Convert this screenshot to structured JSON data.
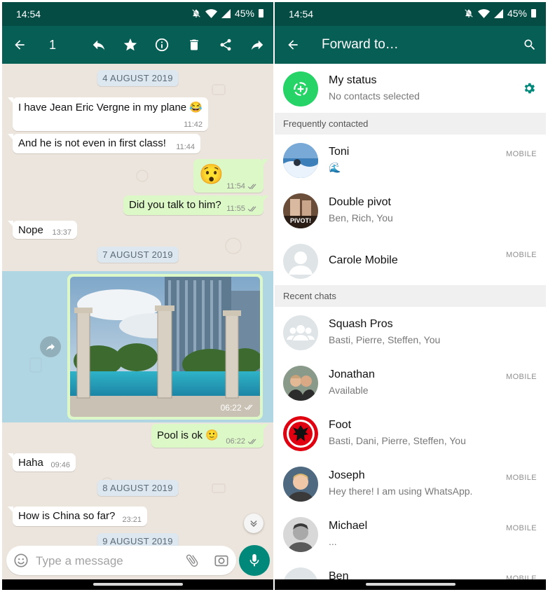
{
  "left": {
    "status_time": "14:54",
    "battery": "45%",
    "selected_count": "1",
    "chat": {
      "dates": [
        "4 AUGUST 2019",
        "7 AUGUST 2019",
        "8 AUGUST 2019",
        "9 AUGUST 2019"
      ],
      "messages": [
        {
          "dir": "in",
          "text": "I have Jean Eric Vergne in my plane 😂",
          "time": "11:42"
        },
        {
          "dir": "in",
          "text": "And he is not even in first class!",
          "time": "11:44"
        },
        {
          "dir": "out",
          "text": "😯",
          "time": "11:54"
        },
        {
          "dir": "out",
          "text": "Did you talk to him?",
          "time": "11:55"
        },
        {
          "dir": "in",
          "text": "Nope",
          "time": "13:37"
        },
        {
          "dir": "out",
          "text": "",
          "time": "06:22",
          "type": "photo"
        },
        {
          "dir": "out",
          "text": "Pool is ok 🙂",
          "time": "06:22"
        },
        {
          "dir": "in",
          "text": "Haha",
          "time": "09:46"
        },
        {
          "dir": "in",
          "text": "How is China so far?",
          "time": "23:21"
        }
      ]
    },
    "composer": {
      "placeholder": "Type a message"
    },
    "icons": {
      "back": "arrow-left-icon",
      "reply": "reply-icon",
      "star": "star-icon",
      "info": "info-icon",
      "delete": "trash-icon",
      "share": "share-icon",
      "forward": "forward-icon",
      "emoji": "emoji-icon",
      "attach": "paperclip-icon",
      "camera": "camera-icon",
      "mic": "mic-icon"
    }
  },
  "right": {
    "status_time": "14:54",
    "battery": "45%",
    "title": "Forward to…",
    "my_status": {
      "name": "My status",
      "sub": "No contacts selected"
    },
    "sections": {
      "frequent": "Frequently contacted",
      "recent": "Recent chats"
    },
    "frequent": [
      {
        "name": "Toni",
        "sub": "🌊",
        "tag": "MOBILE"
      },
      {
        "name": "Double pivot",
        "sub": "Ben, Rich, You",
        "tag": "",
        "avatar_text": "PIVOT!"
      },
      {
        "name": "Carole Mobile",
        "sub": "",
        "tag": "MOBILE"
      }
    ],
    "recent": [
      {
        "name": "Squash Pros",
        "sub": "Basti, Pierre, Steffen, You",
        "tag": ""
      },
      {
        "name": "Jonathan",
        "sub": "Available",
        "tag": "MOBILE"
      },
      {
        "name": "Foot",
        "sub": "Basti, Dani, Pierre, Steffen, You",
        "tag": ""
      },
      {
        "name": "Joseph",
        "sub": "Hey there! I am using WhatsApp.",
        "tag": "MOBILE"
      },
      {
        "name": "Michael",
        "sub": "...",
        "tag": "MOBILE"
      },
      {
        "name": "Ben",
        "sub": "",
        "tag": "MOBILE"
      }
    ]
  },
  "colors": {
    "header": "#075e54",
    "status_bar": "#054d44",
    "accent": "#00897b",
    "out_bubble": "#dcf8c6",
    "status_ring": "#25d366"
  }
}
